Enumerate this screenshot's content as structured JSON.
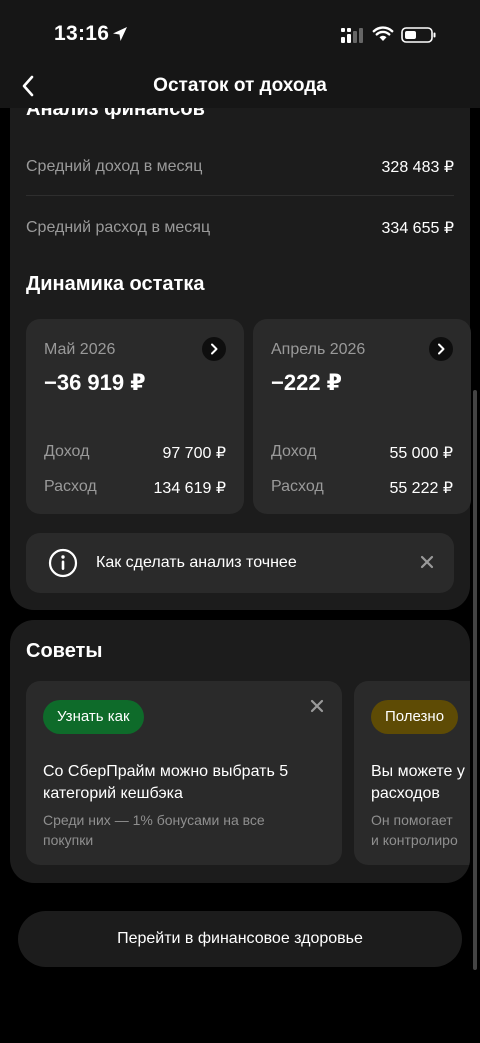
{
  "status_bar": {
    "time": "13:16"
  },
  "nav": {
    "title": "Остаток от дохода"
  },
  "analysis": {
    "title": "Анализ финансов",
    "avg_income_label": "Средний доход в месяц",
    "avg_income_value": "328 483 ₽",
    "avg_expense_label": "Средний расход в месяц",
    "avg_expense_value": "334 655 ₽"
  },
  "dynamics": {
    "title": "Динамика остатка",
    "months": [
      {
        "name": "Май 2026",
        "balance": "−36 919 ₽",
        "income_label": "Доход",
        "income": "97 700 ₽",
        "expense_label": "Расход",
        "expense": "134 619 ₽"
      },
      {
        "name": "Апрель 2026",
        "balance": "−222 ₽",
        "income_label": "Доход",
        "income": "55 000 ₽",
        "expense_label": "Расход",
        "expense": "55 222 ₽"
      }
    ],
    "tip": "Как сделать анализ точнее"
  },
  "advice": {
    "title": "Советы",
    "items": [
      {
        "tag": "Узнать как",
        "tag_color": "#0e6b2a",
        "headline": "Со СберПрайм можно выбрать 5\nкатегорий кешбэка",
        "sub": "Среди них — 1% бонусами на все\nпокупки"
      },
      {
        "tag": "Полезно",
        "tag_color": "#5e4b05",
        "headline": "Вы можете у\nрасходов",
        "sub": "Он помогает\nи контролиро"
      }
    ]
  },
  "cta": {
    "label": "Перейти в финансовое здоровье"
  },
  "icons": [
    "location-arrow-icon",
    "signal-icon",
    "wifi-icon",
    "battery-icon",
    "back-chevron-icon",
    "chevron-right-icon",
    "info-icon",
    "close-icon"
  ]
}
